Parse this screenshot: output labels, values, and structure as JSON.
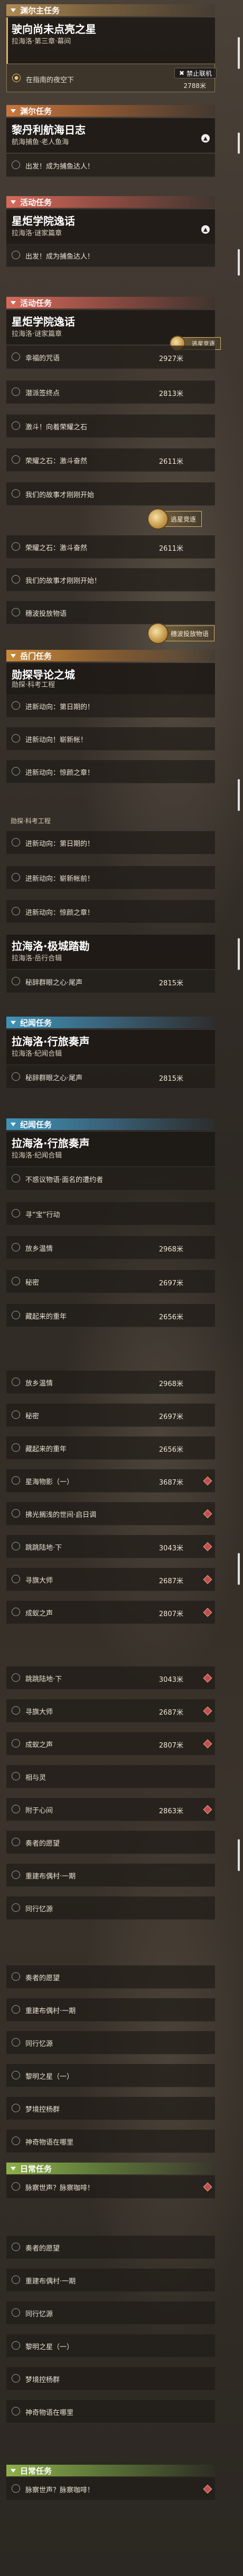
{
  "headers": {
    "main_quest": "渊尔主任务",
    "side_quest": "渊尔任务",
    "event_quest": "活动任务",
    "event_quest_2": "活动任务",
    "legend_quest": "岳门任务",
    "realm_quest": "纪闻任务",
    "realm_quest_2": "纪闻任务",
    "daily_quest": "日常任务",
    "daily_quest_2": "日常任务"
  },
  "main_card": {
    "title": "驶向尚未点亮之星",
    "subtitle": "拉海洛·第三章·幕间",
    "active_label": "在指南的夜空下",
    "active_dist": "2788米",
    "banner_disable": "禁止联机"
  },
  "side_card": {
    "title": "黎丹利航海日志",
    "subtitle": "航海捕鱼·老人鱼海",
    "item": "出发！成为捕鱼达人！"
  },
  "event_card": {
    "title": "星炬学院逸话",
    "subtitle": "拉海洛·谜家篇章",
    "item": "出发！成为捕鱼达人！"
  },
  "event_card_2": {
    "title": "星炬学院逸话",
    "subtitle": "拉海洛·谜家篇章",
    "banner": "逃星竞逐",
    "items": [
      {
        "label": "幸福的咒语",
        "dist": "2927米"
      },
      {
        "label": "潜派签终点",
        "dist": "2813米"
      },
      {
        "label": "激斗！向着荣耀之石",
        "dist": ""
      },
      {
        "label": "荣耀之石：激斗奋然",
        "dist": "2611米"
      },
      {
        "label": "我们的故事才刚刚开始",
        "dist": ""
      }
    ],
    "banner_2": "逃星竞逐",
    "items_2": [
      {
        "label": "荣耀之石：激斗奋然",
        "dist": "2611米"
      },
      {
        "label": "我们的故事才刚刚开始！",
        "dist": ""
      },
      {
        "label": "穗波投放物语",
        "dist": ""
      }
    ],
    "banner_3": "穗波投放物语"
  },
  "legend_card": {
    "title": "勋探导论之城",
    "subtitle": "勋探·科考工程",
    "items": [
      {
        "label": "进新动向：第日期的！"
      },
      {
        "label": "进新动向！崭新帐！"
      },
      {
        "label": "进新动向：惊颜之章！"
      }
    ],
    "subtitle_2": "勋探·科考工程",
    "items_2": [
      {
        "label": "进新动向：第日期的！"
      },
      {
        "label": "进新动向：崭新帐前！"
      },
      {
        "label": "进新动向：惊颜之章！"
      }
    ]
  },
  "realm_card": {
    "title": "拉海洛·极城踏勘",
    "subtitle": "拉海洛·岳行合辑",
    "item": {
      "label": "秘辞群眼之心·尾声",
      "dist": "2815米"
    }
  },
  "realm_card_2": {
    "title": "拉海洛·行旅奏声",
    "subtitle": "拉海洛·纪闻合辑",
    "item": {
      "label": "秘辞群眼之心·尾声",
      "dist": "2815米"
    }
  },
  "realm_card_3": {
    "title": "拉海洛·行旅奏声",
    "subtitle": "拉海洛·纪闻合辑",
    "items": [
      {
        "label": "不惑议物语·面名的遭约者",
        "dist": ""
      },
      {
        "label": "寻“宝”行动",
        "dist": ""
      },
      {
        "label": "放乡温情",
        "dist": "2968米"
      },
      {
        "label": "秘密",
        "dist": "2697米"
      },
      {
        "label": "藏起来的重年",
        "dist": "2656米"
      }
    ],
    "items_2": [
      {
        "label": "放乡温情",
        "dist": "2968米"
      },
      {
        "label": "秘密",
        "dist": "2697米"
      },
      {
        "label": "藏起来的重年",
        "dist": "2656米"
      },
      {
        "label": "星海物影（一）",
        "dist": "3687米"
      },
      {
        "label": "拂光搁浅的世间·启日调",
        "dist": ""
      },
      {
        "label": "跳跳陆地·下",
        "dist": "3043米"
      },
      {
        "label": "寻旗大师",
        "dist": "2687米"
      },
      {
        "label": "成蚁之声",
        "dist": "2807米"
      }
    ],
    "items_3": [
      {
        "label": "跳跳陆地·下",
        "dist": "3043米"
      },
      {
        "label": "寻旗大师",
        "dist": "2687米"
      },
      {
        "label": "成蚁之声",
        "dist": "2807米"
      },
      {
        "label": "相与灵",
        "dist": ""
      },
      {
        "label": "附于心间",
        "dist": "2863米"
      },
      {
        "label": "奏者的愿望",
        "dist": ""
      },
      {
        "label": "重建布偶村·一期",
        "dist": ""
      },
      {
        "label": "同行忆源",
        "dist": ""
      }
    ],
    "items_4": [
      {
        "label": "奏者的愿望"
      },
      {
        "label": "重建布偶村·一期"
      },
      {
        "label": "同行忆源"
      },
      {
        "label": "黎明之星（一）"
      },
      {
        "label": "梦境控杨群"
      },
      {
        "label": "神奇物语在哪里"
      }
    ]
  },
  "daily_card": {
    "item": "脉察世声？脉察咖啡！"
  },
  "realm_card_4": {
    "items": [
      {
        "label": "奏者的愿望"
      },
      {
        "label": "重建布偶村·一期"
      },
      {
        "label": "同行忆源"
      },
      {
        "label": "黎明之星（一）"
      },
      {
        "label": "梦境控杨群"
      },
      {
        "label": "神奇物语在哪里"
      }
    ]
  },
  "daily_card_2": {
    "item": "脉察世声？脉察咖啡！"
  },
  "colors": {
    "main": "#b08a52",
    "side": "#c9763d",
    "event": "#d66a5a",
    "legend": "#c88a3a",
    "realm": "#3e93b8",
    "daily": "#8db04a",
    "pin": "#c2504a"
  }
}
